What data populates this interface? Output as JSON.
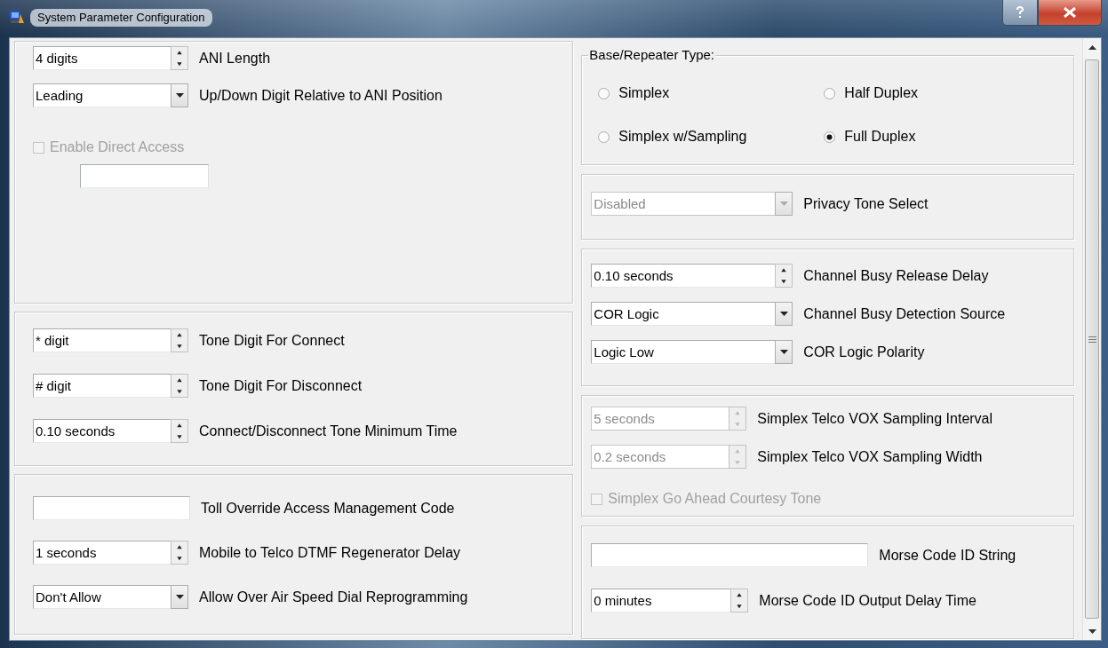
{
  "window": {
    "title": "System Parameter Configuration"
  },
  "left_panels": [
    {
      "rows": [
        {
          "kind": "spin",
          "value": "4 digits",
          "label": "ANI Length",
          "disabled": false
        },
        {
          "kind": "combo",
          "value": "Leading",
          "label": "Up/Down Digit Relative to ANI Position",
          "disabled": false
        },
        {
          "kind": "checkbox",
          "label": "Enable Direct Access",
          "checked": false,
          "disabled": true,
          "field": {
            "kind": "text"
          }
        }
      ]
    },
    {
      "rows": [
        {
          "kind": "spin",
          "value": "* digit",
          "label": "Tone Digit For Connect",
          "disabled": false
        },
        {
          "kind": "spin",
          "value": "# digit",
          "label": "Tone Digit For Disconnect",
          "disabled": false
        },
        {
          "kind": "spin",
          "value": "0.10 seconds",
          "label": "Connect/Disconnect Tone Minimum Time",
          "disabled": false
        }
      ]
    },
    {
      "rows": [
        {
          "kind": "text",
          "label": "Toll Override Access Management Code",
          "disabled": false
        },
        {
          "kind": "spin",
          "value": "1 seconds",
          "label": "Mobile to Telco DTMF Regenerator Delay",
          "disabled": false
        },
        {
          "kind": "combo",
          "value": "Don't Allow",
          "label": "Allow Over Air Speed Dial Reprogramming",
          "disabled": false
        }
      ]
    }
  ],
  "right_panels": [
    {
      "title": "Base/Repeater Type:",
      "rows": [
        {
          "kind": "radio_group",
          "options": [
            {
              "label": "Simplex",
              "selected": false
            },
            {
              "label": "Half Duplex",
              "selected": false
            },
            {
              "label": "Simplex w/Sampling",
              "selected": false
            },
            {
              "label": "Full Duplex",
              "selected": true
            }
          ]
        }
      ]
    },
    {
      "rows": [
        {
          "kind": "combo",
          "value": "Disabled",
          "label": "Privacy Tone Select",
          "disabled": true
        }
      ]
    },
    {
      "rows": [
        {
          "kind": "spin",
          "value": "0.10 seconds",
          "label": "Channel Busy Release Delay",
          "disabled": false
        },
        {
          "kind": "combo",
          "value": "COR Logic",
          "label": "Channel Busy Detection Source",
          "disabled": false
        },
        {
          "kind": "combo",
          "value": "Logic Low",
          "label": "COR Logic Polarity",
          "disabled": false
        }
      ]
    },
    {
      "rows": [
        {
          "kind": "spin",
          "value": "5 seconds",
          "label": "Simplex Telco VOX Sampling Interval",
          "disabled": true
        },
        {
          "kind": "spin",
          "value": "0.2 seconds",
          "label": "Simplex Telco VOX Sampling Width",
          "disabled": true
        },
        {
          "kind": "checkbox",
          "label": "Simplex Go Ahead Courtesy Tone",
          "checked": false,
          "disabled": true
        }
      ]
    },
    {
      "rows": [
        {
          "kind": "text",
          "label": "Morse Code ID String",
          "disabled": false
        },
        {
          "kind": "spin",
          "value": "0 minutes",
          "label": "Morse Code ID Output Delay Time",
          "disabled": false
        }
      ]
    }
  ]
}
